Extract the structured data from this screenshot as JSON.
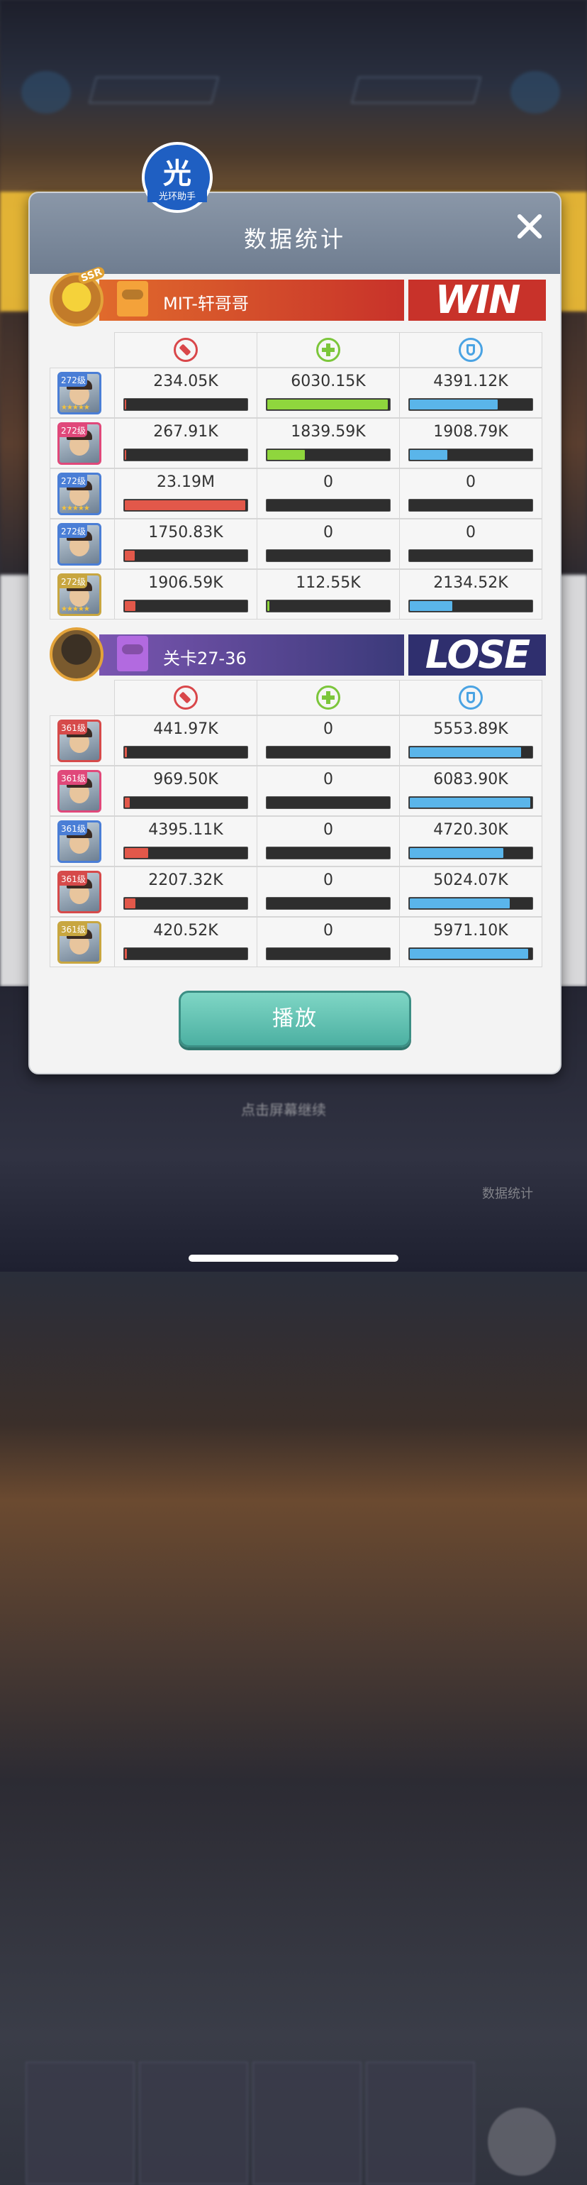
{
  "watermark": {
    "glyph": "光",
    "label": "光环助手"
  },
  "dialog": {
    "title": "数据统计"
  },
  "background": {
    "prompt_text": "点击屏幕继续",
    "stat_button_label": "数据统计"
  },
  "teams": [
    {
      "name": "MIT-轩哥哥",
      "result": "WIN",
      "avatar_tag": "SSR",
      "rows": [
        {
          "level": "272级",
          "stars": "★★★★★",
          "frame_color": "#4a7ed6",
          "damage": "234.05K",
          "damage_fill": 0.01,
          "heal": "6030.15K",
          "heal_fill": 0.99,
          "shield": "4391.12K",
          "shield_fill": 0.72
        },
        {
          "level": "272级",
          "stars": "",
          "frame_color": "#e0487a",
          "damage": "267.91K",
          "damage_fill": 0.01,
          "heal": "1839.59K",
          "heal_fill": 0.31,
          "shield": "1908.79K",
          "shield_fill": 0.31
        },
        {
          "level": "272级",
          "stars": "★★★★★",
          "frame_color": "#4a7ed6",
          "damage": "23.19M",
          "damage_fill": 0.99,
          "heal": "0",
          "heal_fill": 0,
          "shield": "0",
          "shield_fill": 0
        },
        {
          "level": "272级",
          "stars": "",
          "frame_color": "#4a7ed6",
          "damage": "1750.83K",
          "damage_fill": 0.08,
          "heal": "0",
          "heal_fill": 0,
          "shield": "0",
          "shield_fill": 0
        },
        {
          "level": "272级",
          "stars": "★★★★★",
          "frame_color": "#c8a640",
          "damage": "1906.59K",
          "damage_fill": 0.09,
          "heal": "112.55K",
          "heal_fill": 0.02,
          "shield": "2134.52K",
          "shield_fill": 0.35
        }
      ]
    },
    {
      "name": "关卡27-36",
      "result": "LOSE",
      "avatar_tag": "",
      "rows": [
        {
          "level": "361级",
          "stars": "",
          "frame_color": "#d64a4a",
          "damage": "441.97K",
          "damage_fill": 0.02,
          "heal": "0",
          "heal_fill": 0,
          "shield": "5553.89K",
          "shield_fill": 0.91
        },
        {
          "level": "361级",
          "stars": "",
          "frame_color": "#e0487a",
          "damage": "969.50K",
          "damage_fill": 0.04,
          "heal": "0",
          "heal_fill": 0,
          "shield": "6083.90K",
          "shield_fill": 0.99
        },
        {
          "level": "361级",
          "stars": "",
          "frame_color": "#4a7ed6",
          "damage": "4395.11K",
          "damage_fill": 0.19,
          "heal": "0",
          "heal_fill": 0,
          "shield": "4720.30K",
          "shield_fill": 0.77
        },
        {
          "level": "361级",
          "stars": "",
          "frame_color": "#d64a4a",
          "damage": "2207.32K",
          "damage_fill": 0.09,
          "heal": "0",
          "heal_fill": 0,
          "shield": "5024.07K",
          "shield_fill": 0.82
        },
        {
          "level": "361级",
          "stars": "",
          "frame_color": "#c8a640",
          "damage": "420.52K",
          "damage_fill": 0.02,
          "heal": "0",
          "heal_fill": 0,
          "shield": "5971.10K",
          "shield_fill": 0.97
        }
      ]
    }
  ],
  "column_icons": [
    "damage-icon",
    "heal-icon",
    "shield-icon"
  ],
  "colors": {
    "win": "#c8322a",
    "lose": "#2f2f6e",
    "damage_bar": "#e2584a",
    "heal_bar": "#8fd63d",
    "shield_bar": "#5ab5ea",
    "play_button": "#5cc0b2"
  },
  "actions": {
    "play_label": "播放"
  }
}
